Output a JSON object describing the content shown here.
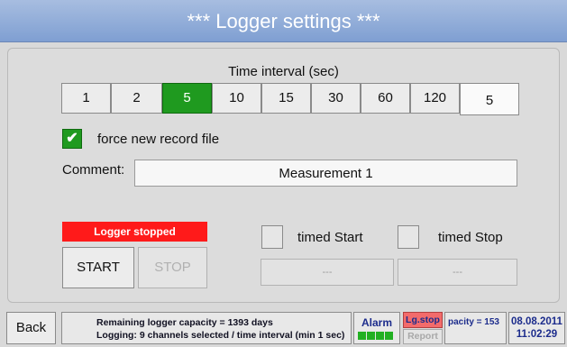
{
  "title": "***   Logger settings   ***",
  "time_interval": {
    "label": "Time interval (sec)",
    "options": [
      "1",
      "2",
      "5",
      "10",
      "15",
      "30",
      "60",
      "120"
    ],
    "selected": "5",
    "custom_value": "5"
  },
  "force_new_record": {
    "label": "force new record file",
    "checked": true,
    "check_symbol": "✔"
  },
  "comment": {
    "label": "Comment:",
    "value": "Measurement 1"
  },
  "logger_status": "Logger stopped",
  "start_label": "START",
  "stop_label": "STOP",
  "timed_start": {
    "label": "timed Start",
    "value": "---"
  },
  "timed_stop": {
    "label": "timed Stop",
    "value": "---"
  },
  "footer": {
    "back_label": "Back",
    "info_line1": "Remaining logger capacity = 1393 days",
    "info_line2": "Logging:  9 channels selected / time interval (min 1 sec)",
    "alarm_label": "Alarm",
    "lg_stop_label": "Lg.stop",
    "report_label": "Report",
    "capacity_label": "pacity = 153",
    "date": "08.08.2011",
    "time": "11:02:29"
  },
  "colors": {
    "accent_green": "#1f9a1f",
    "status_red": "#ff1a1a",
    "title_blue": "#8eabdc",
    "footer_blue": "#1c2c8c"
  }
}
